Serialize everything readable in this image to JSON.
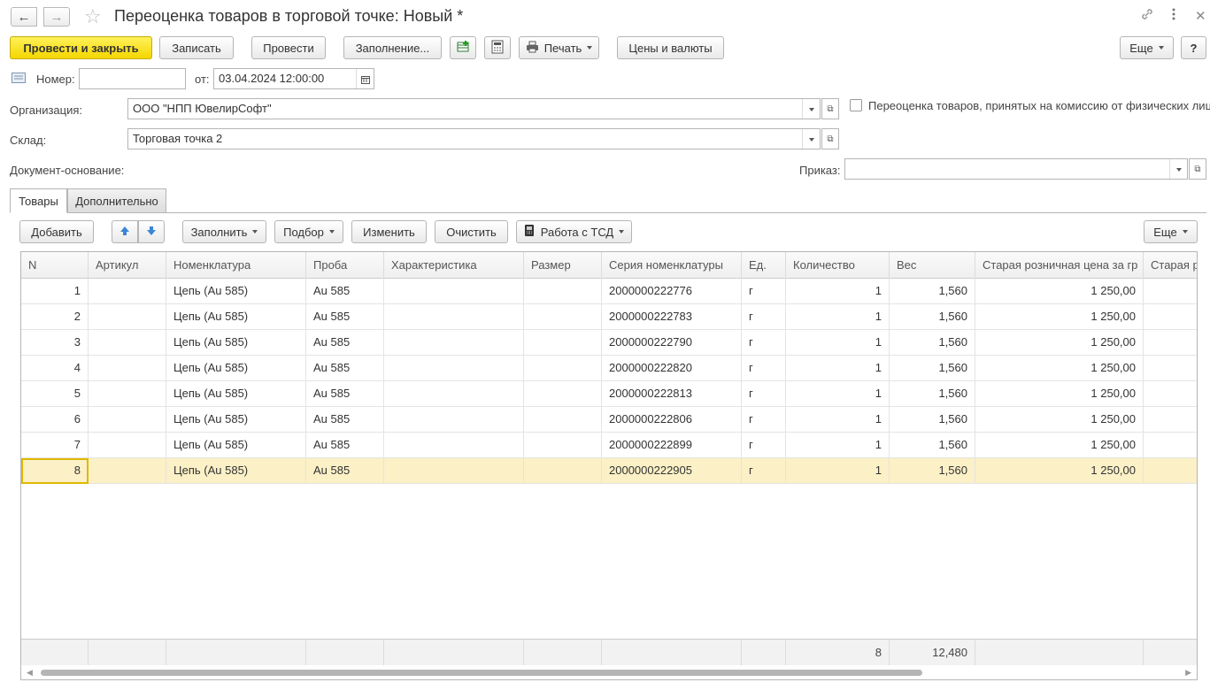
{
  "window": {
    "title": "Переоценка товаров в торговой точке: Новый *"
  },
  "toolbar": {
    "post_close": "Провести и закрыть",
    "save": "Записать",
    "post": "Провести",
    "fill": "Заполнение...",
    "print": "Печать",
    "prices": "Цены и валюты",
    "more": "Еще",
    "help": "?"
  },
  "header": {
    "number_label": "Номер:",
    "number_value": "",
    "date_label": "от:",
    "date_value": "03.04.2024 12:00:00",
    "org_label": "Организация:",
    "org_value": "ООО \"НПП ЮвелирСофт\"",
    "warehouse_label": "Склад:",
    "warehouse_value": "Торговая точка 2",
    "basis_label": "Документ-основание:",
    "order_label": "Приказ:",
    "order_value": "",
    "commission_label": "Переоценка товаров, принятых на комиссию от физических лиц"
  },
  "tabs": [
    "Товары",
    "Дополнительно"
  ],
  "table_toolbar": {
    "add": "Добавить",
    "fill": "Заполнить",
    "pick": "Подбор",
    "edit": "Изменить",
    "clear": "Очистить",
    "tsd": "Работа с ТСД",
    "more": "Еще"
  },
  "table": {
    "columns": [
      "N",
      "Артикул",
      "Номенклатура",
      "Проба",
      "Характеристика",
      "Размер",
      "Серия номенклатуры",
      "Ед.",
      "Количество",
      "Вес",
      "Старая розничная цена за гр",
      "Старая р"
    ],
    "rows": [
      [
        "1",
        "",
        "Цепь (Au 585)",
        "Au 585",
        "",
        "",
        "2000000222776",
        "г",
        "1",
        "1,560",
        "1 250,00",
        ""
      ],
      [
        "2",
        "",
        "Цепь (Au 585)",
        "Au 585",
        "",
        "",
        "2000000222783",
        "г",
        "1",
        "1,560",
        "1 250,00",
        ""
      ],
      [
        "3",
        "",
        "Цепь (Au 585)",
        "Au 585",
        "",
        "",
        "2000000222790",
        "г",
        "1",
        "1,560",
        "1 250,00",
        ""
      ],
      [
        "4",
        "",
        "Цепь (Au 585)",
        "Au 585",
        "",
        "",
        "2000000222820",
        "г",
        "1",
        "1,560",
        "1 250,00",
        ""
      ],
      [
        "5",
        "",
        "Цепь (Au 585)",
        "Au 585",
        "",
        "",
        "2000000222813",
        "г",
        "1",
        "1,560",
        "1 250,00",
        ""
      ],
      [
        "6",
        "",
        "Цепь (Au 585)",
        "Au 585",
        "",
        "",
        "2000000222806",
        "г",
        "1",
        "1,560",
        "1 250,00",
        ""
      ],
      [
        "7",
        "",
        "Цепь (Au 585)",
        "Au 585",
        "",
        "",
        "2000000222899",
        "г",
        "1",
        "1,560",
        "1 250,00",
        ""
      ],
      [
        "8",
        "",
        "Цепь (Au 585)",
        "Au 585",
        "",
        "",
        "2000000222905",
        "г",
        "1",
        "1,560",
        "1 250,00",
        ""
      ]
    ],
    "selected_row": 8,
    "totals": {
      "quantity": "8",
      "weight": "12,480"
    }
  },
  "icons": [
    "back-arrow-icon",
    "forward-arrow-icon",
    "star-icon",
    "link-icon",
    "menu-dots-icon",
    "close-icon",
    "add-row-icon",
    "calc-icon",
    "printer-icon",
    "arrow-up-icon",
    "arrow-down-icon",
    "scanner-icon",
    "calendar-icon",
    "open-icon",
    "dropdown-icon",
    "doc-list-icon"
  ],
  "colors": {
    "primary_button": "#f5d600",
    "selected_row": "#fbf0c6"
  }
}
